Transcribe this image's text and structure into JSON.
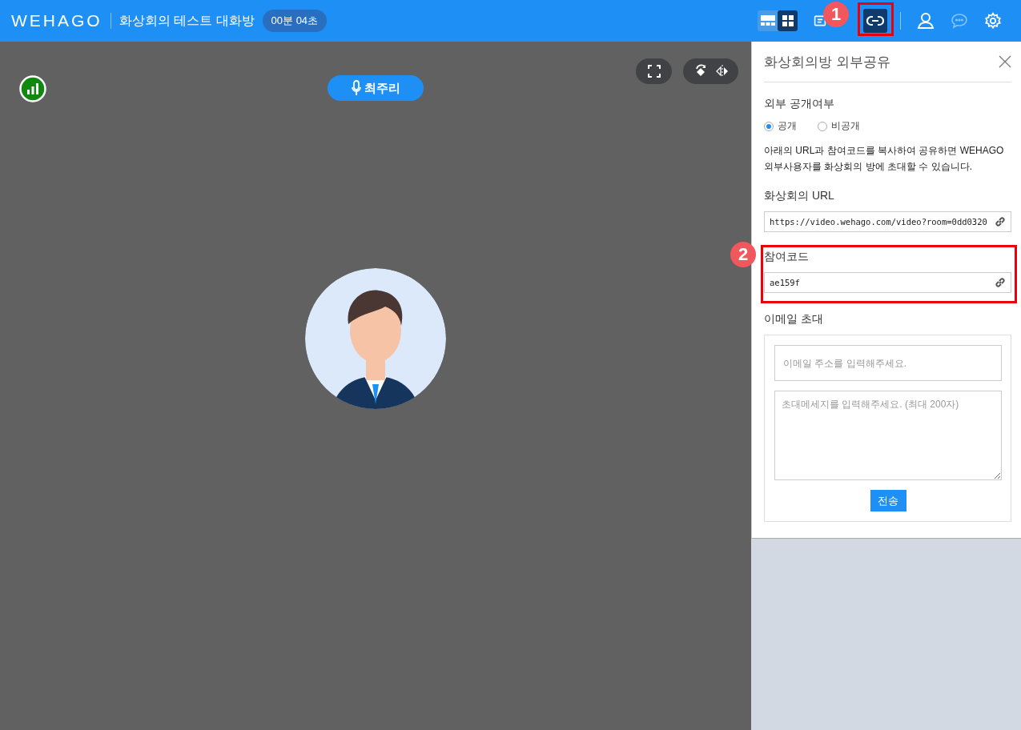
{
  "header": {
    "logo": "WEHAGO",
    "room_title": "화상회의 테스트 대화방",
    "timer": "00분 04초",
    "toolbar": [
      {
        "kind": "layout-list",
        "selected": false,
        "disabled": false
      },
      {
        "kind": "layout-grid",
        "selected": true,
        "disabled": false
      },
      {
        "kind": "document",
        "selected": false,
        "disabled": false
      },
      {
        "kind": "link",
        "selected": true,
        "disabled": false
      },
      {
        "kind": "person",
        "selected": false,
        "disabled": false
      },
      {
        "kind": "chat",
        "selected": false,
        "disabled": true
      },
      {
        "kind": "settings",
        "selected": false,
        "disabled": false
      }
    ]
  },
  "video": {
    "speaker": "최주리"
  },
  "share_panel": {
    "title": "화상회의방 외부공유",
    "visibility": {
      "label": "외부 공개여부",
      "options": [
        {
          "label": "공개",
          "selected": true
        },
        {
          "label": "비공개",
          "selected": false
        }
      ]
    },
    "description": "아래의 URL과 참여코드를 복사하여 공유하면 WEHAGO 외부사용자를 화상회의 방에 초대할 수 있습니다.",
    "url": {
      "label": "화상회의 URL",
      "value": "https://video.wehago.com/video?room=0dd0320"
    },
    "code": {
      "label": "참여코드",
      "value": "ae159f"
    },
    "email": {
      "label": "이메일 초대",
      "address_placeholder": "이메일 주소를 입력해주세요.",
      "message_placeholder": "초대메세지를 입력해주세요. (최대 200자)",
      "send": "전송"
    }
  },
  "annotations": [
    {
      "label": "1"
    },
    {
      "label": "2"
    }
  ]
}
